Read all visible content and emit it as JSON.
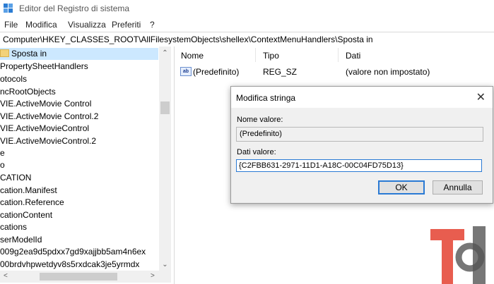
{
  "window": {
    "title": "Editor del Registro di sistema"
  },
  "menu": [
    "File",
    "Modifica",
    "Visualizza",
    "Preferiti",
    "?"
  ],
  "address": "Computer\\HKEY_CLASSES_ROOT\\AllFilesystemObjects\\shellex\\ContextMenuHandlers\\Sposta in",
  "tree": {
    "items": [
      "Sposta in",
      "PropertySheetHandlers",
      "otocols",
      "ncRootObjects",
      "VIE.ActiveMovie Control",
      "VIE.ActiveMovie Control.2",
      "VIE.ActiveMovieControl",
      "VIE.ActiveMovieControl.2",
      "e",
      "o",
      "CATION",
      "cation.Manifest",
      "cation.Reference",
      "cationContent",
      "cations",
      "serModelId",
      "009g2ea9d5pdxx7gd9xajjbb5am4n6ex",
      "00brdvhpwetdyv8s5rxdcak3je5yrmdx"
    ],
    "selected_index": 0
  },
  "list": {
    "columns": [
      "Nome",
      "Tipo",
      "Dati"
    ],
    "rows": [
      {
        "icon": "ab",
        "name": "(Predefinito)",
        "type": "REG_SZ",
        "data": "(valore non impostato)"
      }
    ]
  },
  "dialog": {
    "title": "Modifica stringa",
    "name_label": "Nome valore:",
    "name_value": "(Predefinito)",
    "data_label": "Dati valore:",
    "data_value": "{C2FBB631-2971-11D1-A18C-00C04FD75D13}",
    "ok_label": "OK",
    "cancel_label": "Annulla"
  },
  "colors": {
    "selection": "#cce8ff",
    "accent": "#2a7ad4",
    "logo_red": "#e64b3c"
  }
}
